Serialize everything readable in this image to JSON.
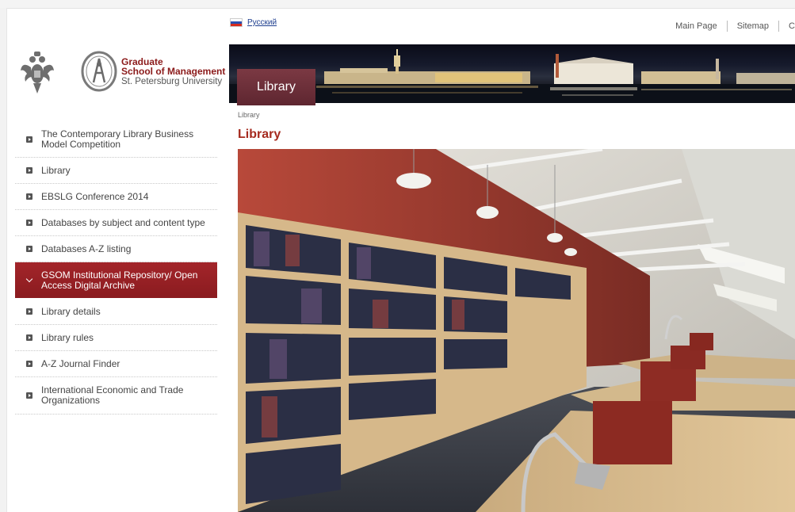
{
  "language": {
    "label": "Русский"
  },
  "top_nav": {
    "main_page": "Main Page",
    "sitemap": "Sitemap",
    "contacts": "C"
  },
  "brand": {
    "line1": "Graduate",
    "line2": "School of Management",
    "line3": "St. Petersburg University"
  },
  "banner": {
    "tab_label": "Library"
  },
  "breadcrumb": "Library",
  "page_title": "Library",
  "sidebar": {
    "items": [
      {
        "label": "The Contemporary Library Business Model Competition",
        "active": false
      },
      {
        "label": "Library",
        "active": false
      },
      {
        "label": "EBSLG Conference 2014",
        "active": false
      },
      {
        "label": "Databases by subject and content type",
        "active": false
      },
      {
        "label": "Databases A-Z listing",
        "active": false
      },
      {
        "label": "GSOM Institutional Repository/ Open Access Digital Archive",
        "active": true
      },
      {
        "label": "Library details",
        "active": false
      },
      {
        "label": "Library rules",
        "active": false
      },
      {
        "label": "A-Z Journal Finder",
        "active": false
      },
      {
        "label": "International Economic and Trade Organizations",
        "active": false
      }
    ]
  },
  "colors": {
    "accent": "#a52a1e",
    "active_menu": "#9a2024",
    "banner_tab": "#6d2f39"
  }
}
